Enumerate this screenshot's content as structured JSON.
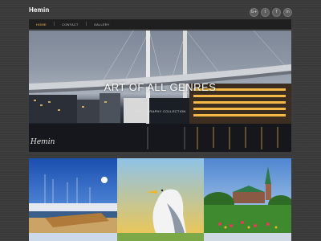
{
  "site": {
    "logo": "Hemin"
  },
  "social": [
    {
      "icon": "google-plus-icon",
      "glyph": "G+"
    },
    {
      "icon": "twitter-icon",
      "glyph": "t"
    },
    {
      "icon": "facebook-icon",
      "glyph": "f"
    },
    {
      "icon": "linkedin-icon",
      "glyph": "in"
    }
  ],
  "nav": {
    "items": [
      {
        "label": "HOME",
        "active": true
      },
      {
        "label": "CONTACT",
        "active": false
      },
      {
        "label": "GALLERY",
        "active": false
      }
    ]
  },
  "hero": {
    "title": "ART OF ALL GENRES",
    "subtitle": "PHOTOGRAPHY COLLECTION",
    "signature": "Hemin"
  },
  "colors": {
    "nav_active": "#f0c040",
    "background": "#3a3a3a",
    "nav_bg": "#1f1f1f"
  },
  "gallery": [
    {
      "subject": "harbor-boats-photo"
    },
    {
      "subject": "seagull-photo"
    },
    {
      "subject": "castle-garden-photo"
    }
  ]
}
